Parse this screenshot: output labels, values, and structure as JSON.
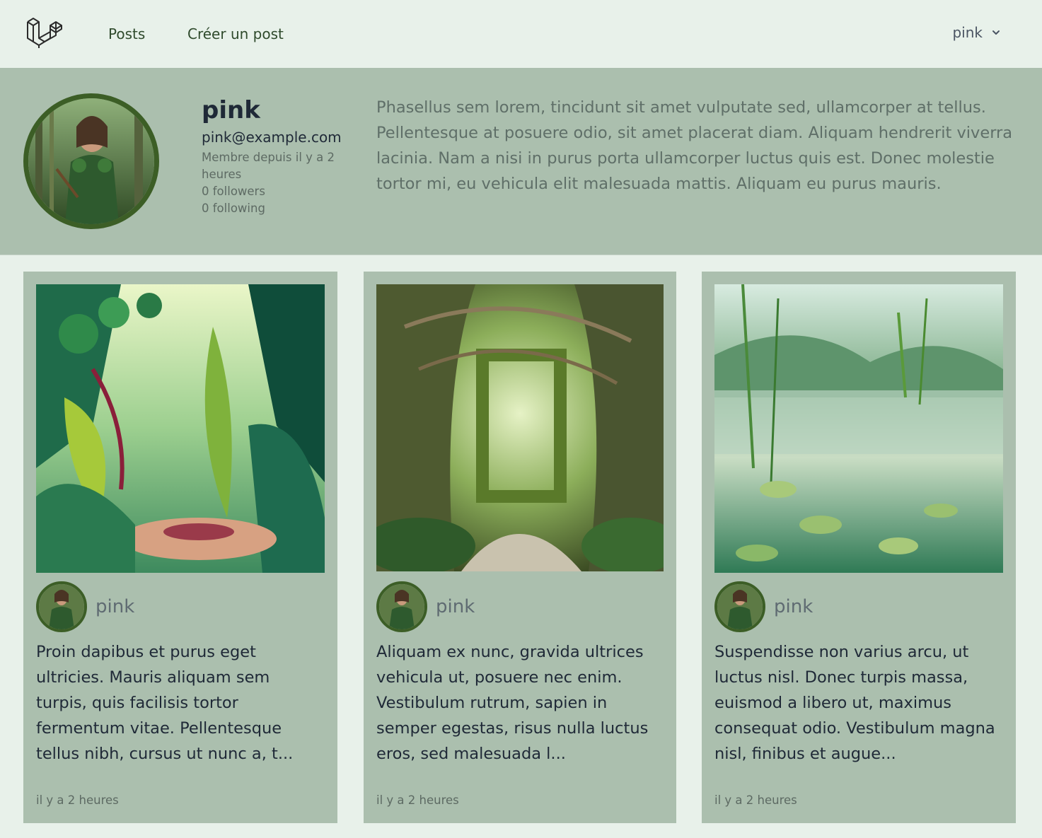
{
  "nav": {
    "logo_icon": "laravel-logo-icon",
    "links": [
      "Posts",
      "Créer un post"
    ],
    "user": "pink"
  },
  "profile": {
    "name": "pink",
    "email": "pink@example.com",
    "member_since": "Membre depuis il y a 2 heures",
    "followers": "0 followers",
    "following": "0 following",
    "bio": "Phasellus sem lorem, tincidunt sit amet vulputate sed, ullamcorper at tellus. Pellentesque at posuere odio, sit amet placerat diam. Aliquam hendrerit viverra lacinia. Nam a nisi in purus porta ullamcorper luctus quis est. Donec molestie tortor mi, eu vehicula elit malesuada mattis. Aliquam eu purus mauris."
  },
  "posts": [
    {
      "author": "pink",
      "excerpt": "Proin dapibus et purus eget ultricies. Mauris aliquam sem turpis, quis facilisis tortor fermentum vitae. Pellentesque tellus nibh, cursus ut nunc a, t...",
      "time": "il y a 2 heures"
    },
    {
      "author": "pink",
      "excerpt": "Aliquam ex nunc, gravida ultrices vehicula ut, posuere nec enim. Vestibulum rutrum, sapien in semper egestas, risus nulla luctus eros, sed malesuada l...",
      "time": "il y a 2 heures"
    },
    {
      "author": "pink",
      "excerpt": "Suspendisse non varius arcu, ut luctus nisl. Donec turpis massa, euismod a libero ut, maximus consequat odio. Vestibulum magna nisl, finibus et augue...",
      "time": "il y a 2 heures"
    }
  ],
  "colors": {
    "page_bg": "#e8f1ea",
    "panel_bg": "#abbfae",
    "avatar_ring": "#3c5e26"
  }
}
